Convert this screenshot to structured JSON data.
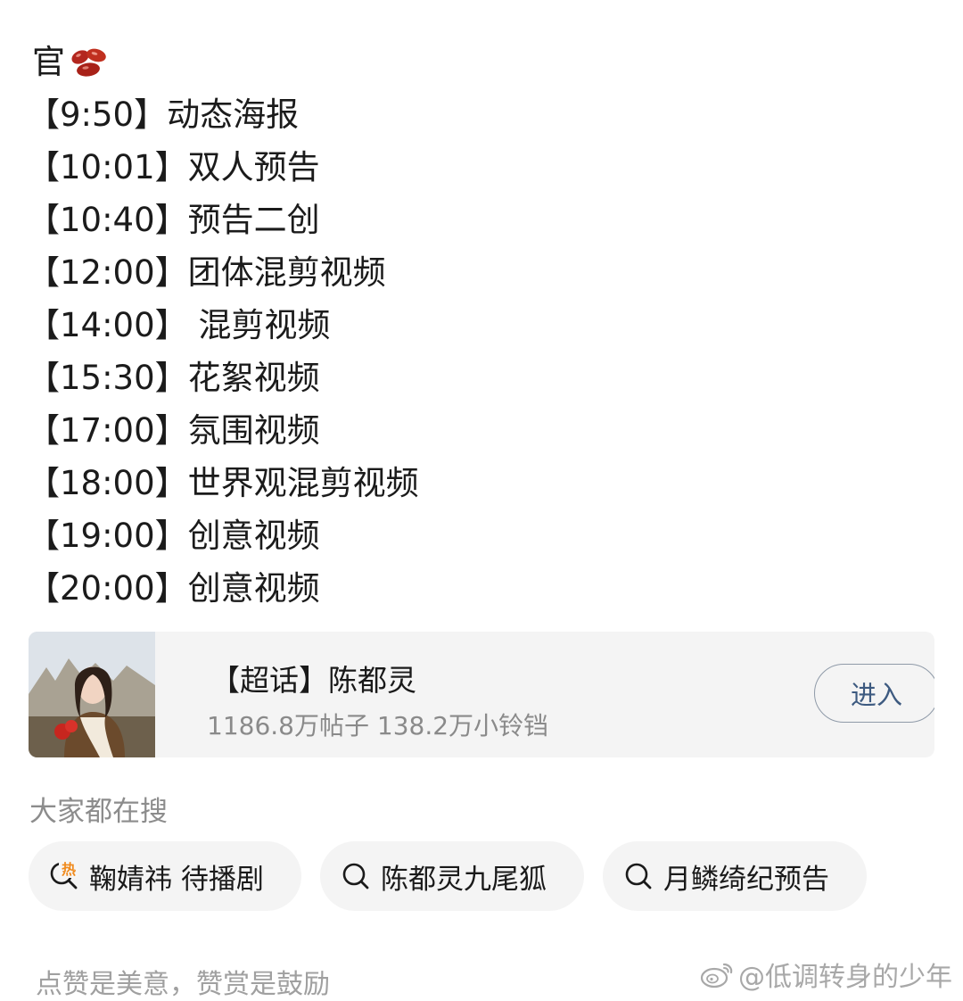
{
  "post": {
    "first_line": "官",
    "emoji": "red-beans-icon",
    "schedule": [
      "【9:50】动态海报",
      "【10:01】双人预告",
      "【10:40】预告二创",
      "【12:00】团体混剪视频",
      "【14:00】 混剪视频",
      "【15:30】花絮视频",
      "【17:00】氛围视频",
      "【18:00】世界观混剪视频",
      "【19:00】创意视频",
      "【20:00】创意视频"
    ]
  },
  "topic_card": {
    "title": "【超话】陈都灵",
    "stats": "1186.8万帖子 138.2万小铃铛",
    "enter_label": "进入"
  },
  "search": {
    "heading": "大家都在搜",
    "chips": [
      {
        "label": "鞠婧祎 待播剧",
        "icon": "hot-search-icon"
      },
      {
        "label": "陈都灵九尾狐",
        "icon": "search-icon"
      },
      {
        "label": "月鳞绮纪预告",
        "icon": "search-icon"
      }
    ]
  },
  "footer": {
    "text": "点赞是美意，赞赏是鼓励"
  },
  "watermark": {
    "text": "@低调转身的少年",
    "logo": "weibo-logo-icon"
  },
  "colors": {
    "accent_button_text": "#3d5a80",
    "hot_icon": "#f08a1c",
    "card_bg": "#f4f4f4"
  }
}
